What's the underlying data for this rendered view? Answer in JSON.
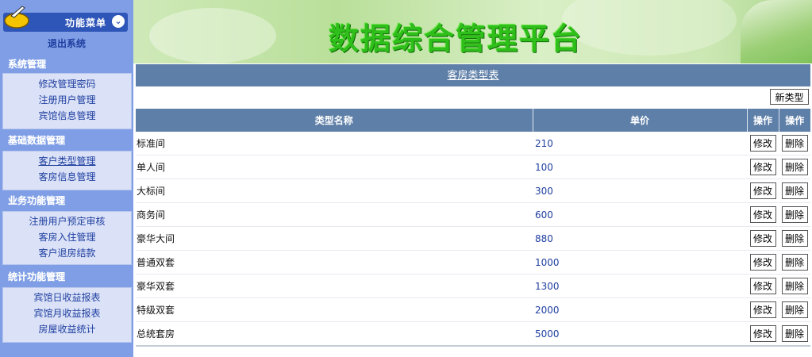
{
  "menu": {
    "title": "功能菜单",
    "logout": "退出系统",
    "sections": [
      {
        "title": "系统管理",
        "items": [
          "修改管理密码",
          "注册用户管理",
          "宾馆信息管理"
        ]
      },
      {
        "title": "基础数据管理",
        "items": [
          "客户类型管理",
          "客房信息管理"
        ]
      },
      {
        "title": "业务功能管理",
        "items": [
          "注册用户预定审核",
          "客房入住管理",
          "客户退房结款"
        ]
      },
      {
        "title": "统计功能管理",
        "items": [
          "宾馆日收益报表",
          "宾馆月收益报表",
          "房屋收益统计"
        ]
      }
    ]
  },
  "banner": {
    "title": "数据综合管理平台"
  },
  "main": {
    "page_title": "客房类型表",
    "new_button": "新类型",
    "columns": [
      "类型名称",
      "单价",
      "操作",
      "操作"
    ],
    "edit_label": "修改",
    "delete_label": "删除",
    "rows": [
      {
        "name": "标准间",
        "price": "210"
      },
      {
        "name": "单人间",
        "price": "100"
      },
      {
        "name": "大标间",
        "price": "300"
      },
      {
        "name": "商务间",
        "price": "600"
      },
      {
        "name": "豪华大间",
        "price": "880"
      },
      {
        "name": "普通双套",
        "price": "1000"
      },
      {
        "name": "豪华双套",
        "price": "1300"
      },
      {
        "name": "特级双套",
        "price": "2000"
      },
      {
        "name": "总统套房",
        "price": "5000"
      }
    ]
  }
}
